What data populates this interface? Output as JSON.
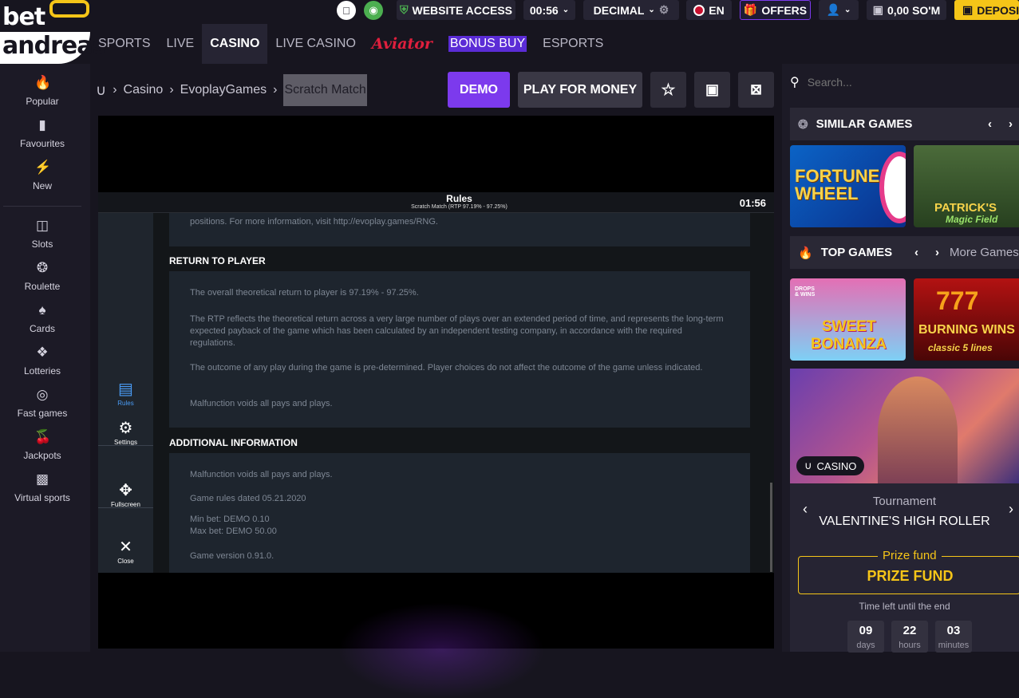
{
  "logo": {
    "line1": "bet",
    "line2": "andreas"
  },
  "topbar": {
    "website_access": "WEBSITE ACCESS",
    "clock": "00:56",
    "odds_format": "DECIMAL",
    "language": "EN",
    "offers": "OFFERS",
    "balance": "0,00 SO'M",
    "deposit": "DEPOSIT"
  },
  "nav": {
    "sports": "SPORTS",
    "live": "LIVE",
    "casino": "CASINO",
    "live_casino": "LIVE CASINO",
    "aviator": "Aviator",
    "bonus_buy": "BONUS BUY",
    "esports": "ESPORTS"
  },
  "sidebar": {
    "items": [
      {
        "label": "Popular"
      },
      {
        "label": "Favourites"
      },
      {
        "label": "New"
      },
      {
        "label": "Slots"
      },
      {
        "label": "Roulette"
      },
      {
        "label": "Cards"
      },
      {
        "label": "Lotteries"
      },
      {
        "label": "Fast games"
      },
      {
        "label": "Jackpots"
      },
      {
        "label": "Virtual sports"
      }
    ]
  },
  "breadcrumb": {
    "casino": "Casino",
    "provider": "EvoplayGames",
    "game": "Scratch Match"
  },
  "actions": {
    "demo": "DEMO",
    "play_for_money": "PLAY FOR MONEY"
  },
  "game": {
    "rules_title": "Rules",
    "rules_subtitle": "Scratch Match (RTP 97.19% - 97.25%)",
    "timer": "01:56",
    "side": {
      "rules": "Rules",
      "settings": "Settings",
      "fullscreen": "Fullscreen",
      "close": "Close"
    },
    "top_text": "positions. For more information, visit http://evoplay.games/RNG.",
    "rtp_heading": "RETURN TO PLAYER",
    "rtp_p1": "The overall theoretical return to player is 97.19% - 97.25%.",
    "rtp_p2": "The RTP reflects the theoretical return across a very large number of plays over an extended period of time, and represents the long-term expected payback of the game which has been calculated by an independent testing company, in accordance with the required regulations.",
    "rtp_p3": "The outcome of any play during the game is pre-determined. Player choices do not affect the outcome of the game unless indicated.",
    "rtp_p4": "Malfunction voids all pays and plays.",
    "add_heading": "ADDITIONAL INFORMATION",
    "add_p1": "Malfunction voids all pays and plays.",
    "add_p2": "Game rules dated 05.21.2020",
    "add_p3": "Min bet: DEMO 0.10",
    "add_p4": "Max bet: DEMO 50.00",
    "add_p5": "Game version 0.91.0."
  },
  "right": {
    "search_placeholder": "Search...",
    "similar_games": "SIMILAR GAMES",
    "top_games": "TOP GAMES",
    "more_games": "More Games",
    "thumbs": {
      "fortune_wheel": "FORTUNE WHEEL",
      "patricks_l1": "PATRICK'S",
      "patricks_l2": "Magic Field",
      "sweet_bonanza_l1": "SWEET",
      "sweet_bonanza_l2": "BONANZA",
      "drops_wins": "DROPS & WINS",
      "burning_l1": "BURNING WINS",
      "burning_l2": "classic 5 lines"
    },
    "promo": {
      "tag": "CASINO",
      "tournament": "Tournament",
      "name": "VALENTINE'S HIGH ROLLER",
      "prize_label": "Prize fund",
      "prize_value": "PRIZE FUND",
      "time_left": "Time left until the end",
      "days": "09",
      "days_label": "days",
      "hours": "22",
      "hours_label": "hours",
      "minutes": "03",
      "minutes_label": "minutes"
    }
  },
  "colors": {
    "accent_purple": "#7c3aed",
    "accent_yellow": "#f5c518",
    "background": "#17151f"
  }
}
